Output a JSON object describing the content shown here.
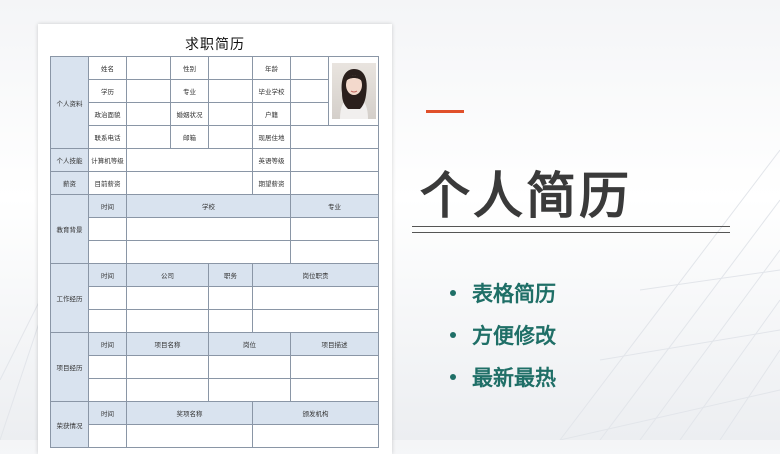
{
  "resume": {
    "title": "求职简历",
    "sections": {
      "personal": "个人资料",
      "skills": "个人技能",
      "salary": "薪资",
      "education": "教育背景",
      "work": "工作经历",
      "project": "项目经历",
      "awards": "荣获情况"
    },
    "fields": {
      "name": "姓名",
      "gender": "性别",
      "age": "年龄",
      "degree": "学历",
      "major": "专业",
      "school": "毕业学校",
      "politics": "政治面貌",
      "marital": "婚姻状况",
      "hukou": "户籍",
      "phone": "联系电话",
      "email": "邮箱",
      "address": "现居住地",
      "computer": "计算机等级",
      "english": "英语等级",
      "current_salary": "目前薪资",
      "expected_salary": "期望薪资"
    },
    "education_headers": [
      "时间",
      "学校",
      "专业"
    ],
    "work_headers": [
      "时间",
      "公司",
      "职务",
      "岗位职责"
    ],
    "project_headers": [
      "时间",
      "项目名称",
      "岗位",
      "项目描述"
    ],
    "award_headers": [
      "时间",
      "奖项名称",
      "颁发机构"
    ]
  },
  "slide": {
    "title": "个人简历",
    "bullets": [
      "表格简历",
      "方便修改",
      "最新最热"
    ],
    "accent_color": "#e0502a",
    "bullet_color": "#1f6f67"
  }
}
